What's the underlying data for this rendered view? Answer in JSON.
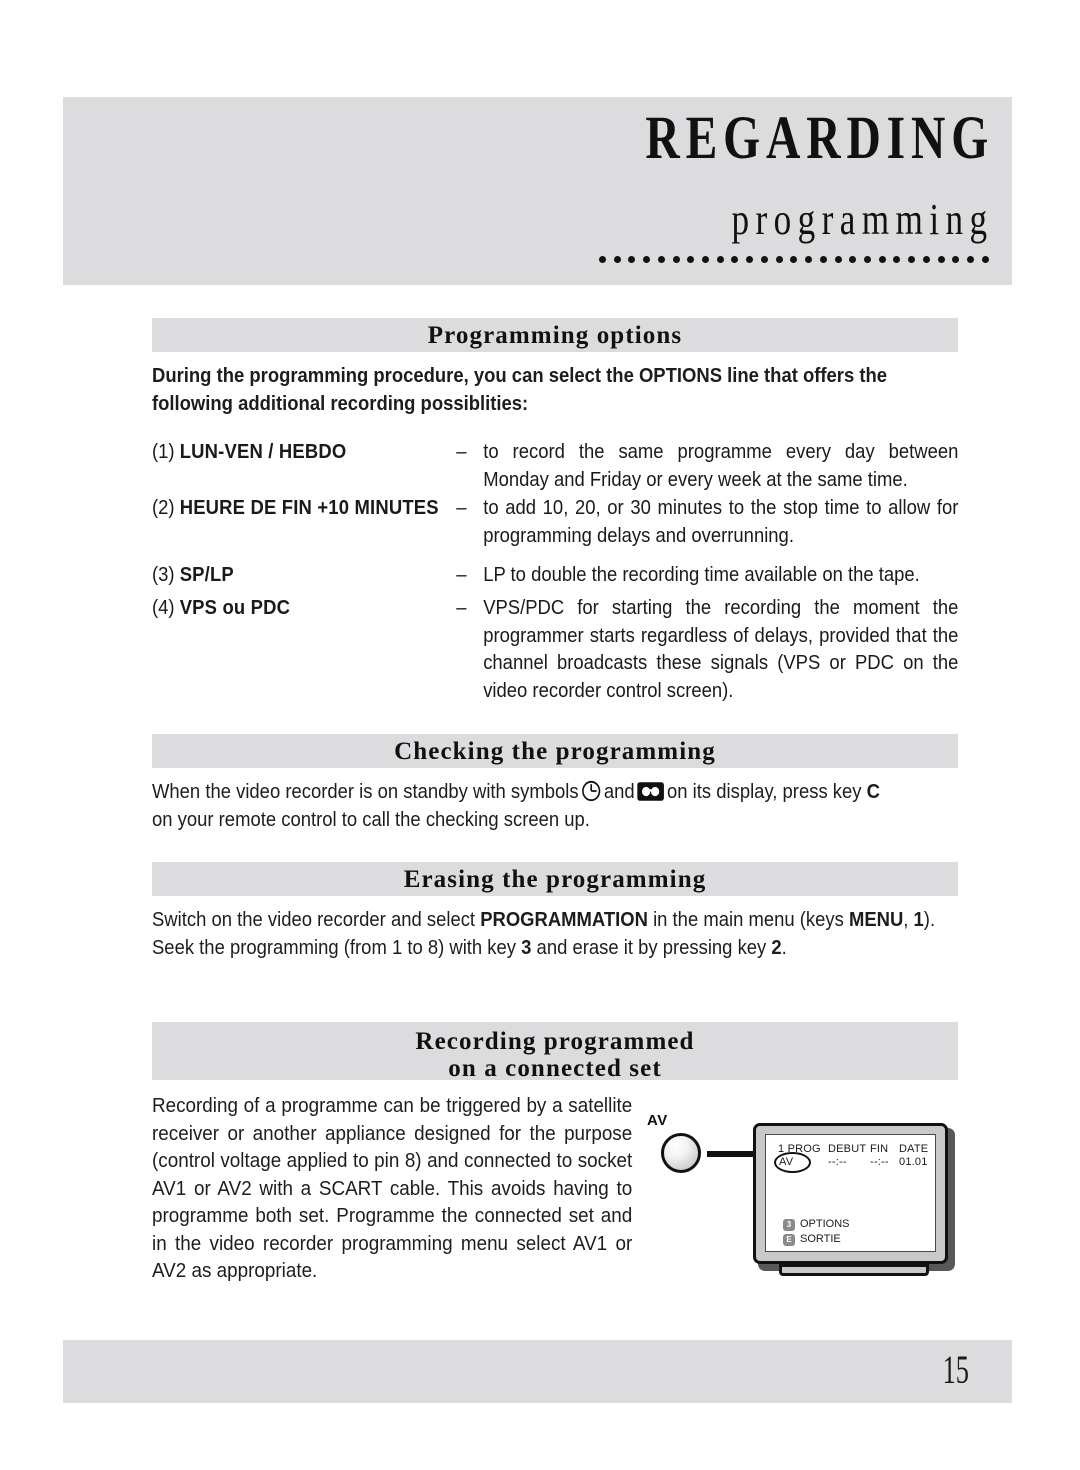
{
  "banner": {
    "title": "REGARDING",
    "subtitle": "programming",
    "dot_count": 27
  },
  "sections": [
    {
      "id": "programming-options",
      "heading": "Programming options",
      "intro": "During the programming procedure, you can select the OPTIONS line that offers the following additional recording possiblities:",
      "options": [
        {
          "number": "(1)",
          "term": "LUN-VEN / HEBDO",
          "dash": "–",
          "description": "to record the same programme every day between Monday and Friday or every week at the same time."
        },
        {
          "number": "(2)",
          "term": "HEURE DE FIN +10 MINUTES",
          "dash": "–",
          "description": "to add 10, 20, or 30 minutes to the stop time to allow for programming delays and overrunning."
        },
        {
          "number": "(3)",
          "term": "SP/LP",
          "dash": "–",
          "description": "LP to double the recording time available on the tape."
        },
        {
          "number": "(4)",
          "term": "VPS ou PDC",
          "dash": "–",
          "description": "VPS/PDC for starting the recording the moment the programmer starts regardless of delays, provided that the channel broadcasts these signals (VPS or PDC on the video recorder control screen)."
        }
      ]
    },
    {
      "id": "checking-the-programming",
      "heading": "Checking the programming",
      "text_part1": "When the video recorder is on standby with symbols",
      "symbol1": "clock-icon",
      "text_part2": "and",
      "symbol2": "cassette-tape-icon",
      "text_part3": "on its display, press key",
      "key": "C",
      "text_part4": "on your remote control to call the checking screen up."
    },
    {
      "id": "erasing-the-programming",
      "heading": "Erasing the programming",
      "text_part1": "Switch on the video recorder and select",
      "bold1": "PROGRAMMATION",
      "text_part2": "in the main menu (keys",
      "bold2": "MENU",
      "text_part3": ",",
      "bold3": "1",
      "text_part4": "). Seek the programming (from 1 to 8) with key",
      "bold4": "3",
      "text_part5": "and erase it by pressing key",
      "bold5": "2",
      "text_part6": "."
    },
    {
      "id": "recording-programmed-on-a-connected-set",
      "heading_line1": "Recording programmed",
      "heading_line2": "on a connected set",
      "paragraph": "Recording of a programme can be triggered by a satellite receiver or another appliance designed for the purpose (control voltage applied to pin 8) and connected to socket AV1 or AV2 with a SCART cable. This avoids having to programme both set. Programme the connected set and in the video recorder programming menu select    AV1 or AV2 as appropriate."
    }
  ],
  "illustration": {
    "source_label": "AV",
    "tv_screen": {
      "headers": {
        "prog": "1 PROG",
        "start": "DEBUT",
        "end": "FIN",
        "date": "DATE"
      },
      "values": {
        "prog": "AV",
        "start": "--:--",
        "end": "--:--",
        "date": "01.01"
      },
      "menu": [
        {
          "badge": "3",
          "label": "OPTIONS"
        },
        {
          "badge": "E",
          "label": "SORTIE"
        }
      ]
    }
  },
  "footer": {
    "page_number": "15"
  },
  "colors": {
    "band_gray": "#dcdcde",
    "text": "#1a1a1a",
    "tv_bezel": "#c9c9c9"
  }
}
